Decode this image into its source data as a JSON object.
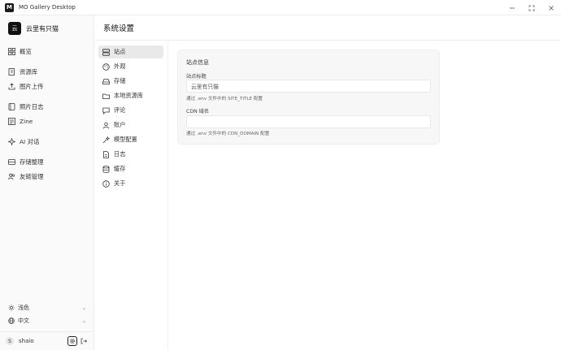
{
  "titlebar": {
    "app_icon": "M",
    "title": "MO Gallery Desktop",
    "controls": [
      "minimize-icon",
      "maximize-icon",
      "close-icon"
    ]
  },
  "brand": {
    "logo_text": "云",
    "name": "云里有只猫"
  },
  "sidebar": {
    "items": [
      {
        "label": "概览",
        "icon": "grid-icon"
      },
      {
        "label": "资源库",
        "icon": "book-icon"
      },
      {
        "label": "图片上传",
        "icon": "upload-icon"
      },
      {
        "label": "照片日志",
        "icon": "journal-icon"
      },
      {
        "label": "Zine",
        "icon": "zine-icon"
      },
      {
        "label": "AI 对话",
        "icon": "sparkle-icon"
      },
      {
        "label": "存储整理",
        "icon": "storage-icon"
      },
      {
        "label": "友链管理",
        "icon": "users-icon"
      }
    ],
    "theme": {
      "label": "浅色",
      "icon": "sun-icon"
    },
    "language": {
      "label": "中文",
      "icon": "globe-icon"
    },
    "user": {
      "initial": "S",
      "name": "shaio"
    }
  },
  "header": {
    "title": "系统设置"
  },
  "settings_nav": {
    "active": 0,
    "items": [
      {
        "label": "站点",
        "icon": "server-icon"
      },
      {
        "label": "外观",
        "icon": "palette-icon"
      },
      {
        "label": "存储",
        "icon": "drive-icon"
      },
      {
        "label": "本地资源库",
        "icon": "folder-icon"
      },
      {
        "label": "评论",
        "icon": "comment-icon"
      },
      {
        "label": "账户",
        "icon": "user-icon"
      },
      {
        "label": "模型配置",
        "icon": "wand-icon"
      },
      {
        "label": "日志",
        "icon": "file-icon"
      },
      {
        "label": "缓存",
        "icon": "database-icon"
      },
      {
        "label": "关于",
        "icon": "info-icon"
      }
    ]
  },
  "site_card": {
    "title": "站点信息",
    "site_title_label": "站点标题",
    "site_title_value": "云里有只猫",
    "site_title_hint": "通过 .env 文件中的 SITE_TITLE 配置",
    "cdn_label": "CDN 域名",
    "cdn_value": "",
    "cdn_hint": "通过 .env 文件中的 CDN_DOMAIN 配置"
  }
}
